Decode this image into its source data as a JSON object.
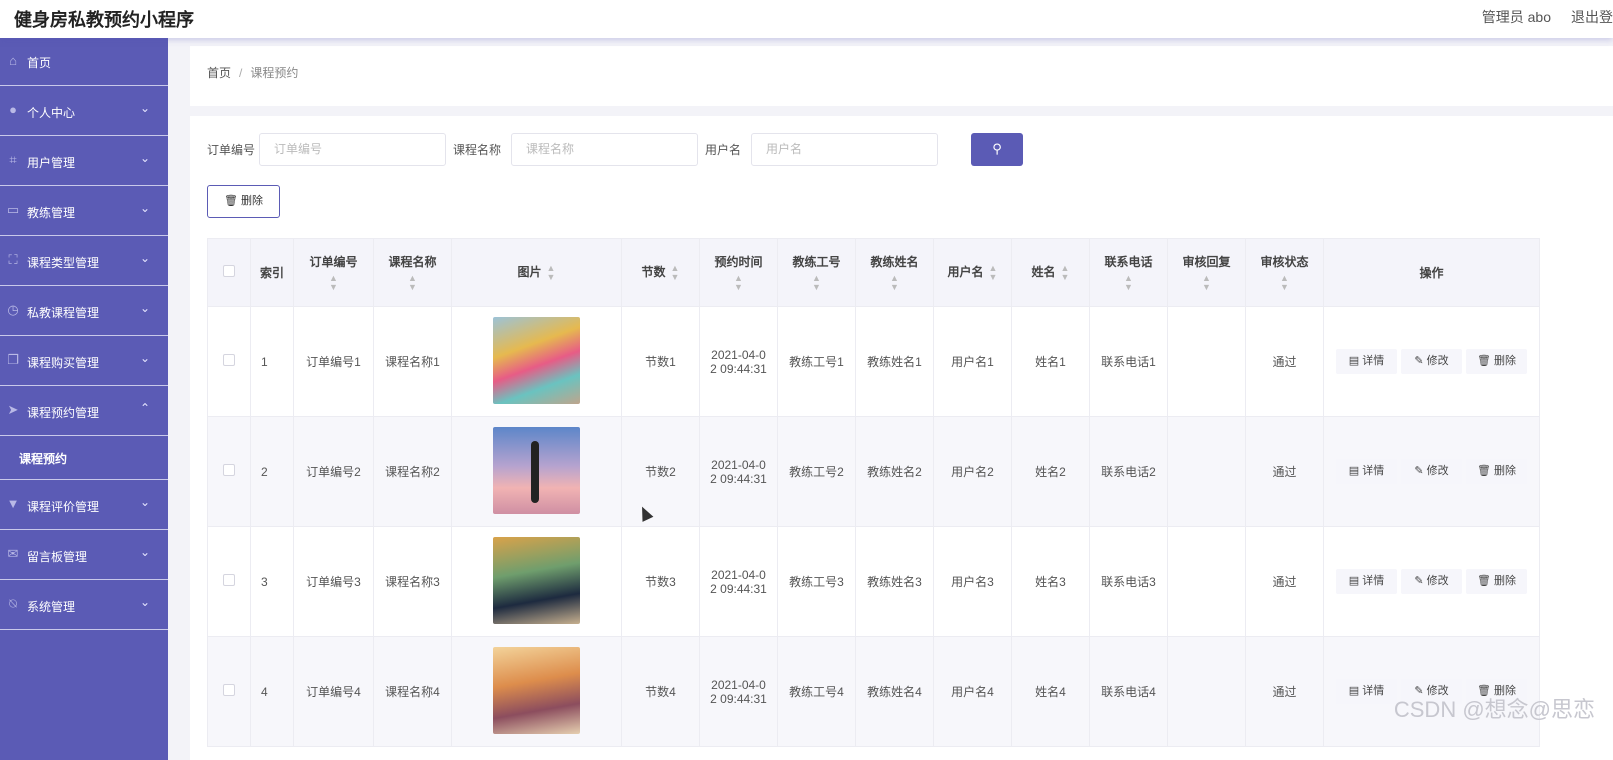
{
  "header": {
    "app_title": "健身房私教预约小程序",
    "admin_label": "管理员 abo",
    "logout_label": "退出登"
  },
  "sidebar": {
    "items": [
      {
        "label": "首页",
        "icon": "home-icon"
      },
      {
        "label": "个人中心",
        "icon": "user-icon"
      },
      {
        "label": "用户管理",
        "icon": "crop-icon"
      },
      {
        "label": "教练管理",
        "icon": "chat-icon"
      },
      {
        "label": "课程类型管理",
        "icon": "frame-icon"
      },
      {
        "label": "私教课程管理",
        "icon": "clock-icon"
      },
      {
        "label": "课程购买管理",
        "icon": "copy-icon"
      },
      {
        "label": "课程预约管理",
        "icon": "send-icon"
      },
      {
        "label": "课程评价管理",
        "icon": "cup-icon"
      },
      {
        "label": "留言板管理",
        "icon": "mail-icon"
      },
      {
        "label": "系统管理",
        "icon": "bell-off-icon"
      }
    ],
    "sub_active": "课程预约"
  },
  "breadcrumb": {
    "home": "首页",
    "current": "课程预约"
  },
  "search": {
    "order_label": "订单编号",
    "order_placeholder": "订单编号",
    "course_label": "课程名称",
    "course_placeholder": "课程名称",
    "user_label": "用户名",
    "user_placeholder": "用户名"
  },
  "toolbar": {
    "delete_label": "删除"
  },
  "table": {
    "headers": [
      "索引",
      "订单编号",
      "课程名称",
      "图片",
      "节数",
      "预约时间",
      "教练工号",
      "教练姓名",
      "用户名",
      "姓名",
      "联系电话",
      "审核回复",
      "审核状态",
      "操作"
    ],
    "rows": [
      {
        "index": "1",
        "order": "订单编号1",
        "course": "课程名称1",
        "sessions": "节数1",
        "time_a": "2021-04-0",
        "time_b": "2 09:44:31",
        "coach_no": "教练工号1",
        "coach_name": "教练姓名1",
        "username": "用户名1",
        "name": "姓名1",
        "phone": "联系电话1",
        "reply": "",
        "status": "通过"
      },
      {
        "index": "2",
        "order": "订单编号2",
        "course": "课程名称2",
        "sessions": "节数2",
        "time_a": "2021-04-0",
        "time_b": "2 09:44:31",
        "coach_no": "教练工号2",
        "coach_name": "教练姓名2",
        "username": "用户名2",
        "name": "姓名2",
        "phone": "联系电话2",
        "reply": "",
        "status": "通过"
      },
      {
        "index": "3",
        "order": "订单编号3",
        "course": "课程名称3",
        "sessions": "节数3",
        "time_a": "2021-04-0",
        "time_b": "2 09:44:31",
        "coach_no": "教练工号3",
        "coach_name": "教练姓名3",
        "username": "用户名3",
        "name": "姓名3",
        "phone": "联系电话3",
        "reply": "",
        "status": "通过"
      },
      {
        "index": "4",
        "order": "订单编号4",
        "course": "课程名称4",
        "sessions": "节数4",
        "time_a": "2021-04-0",
        "time_b": "2 09:44:31",
        "coach_no": "教练工号4",
        "coach_name": "教练姓名4",
        "username": "用户名4",
        "name": "姓名4",
        "phone": "联系电话4",
        "reply": "",
        "status": "通过"
      }
    ],
    "actions": {
      "detail": "详情",
      "edit": "修改",
      "delete": "删除"
    }
  },
  "watermark": "CSDN @想念@思恋",
  "colors": {
    "accent": "#5b5bb5",
    "sidebar_bg": "#5b5bb5"
  }
}
